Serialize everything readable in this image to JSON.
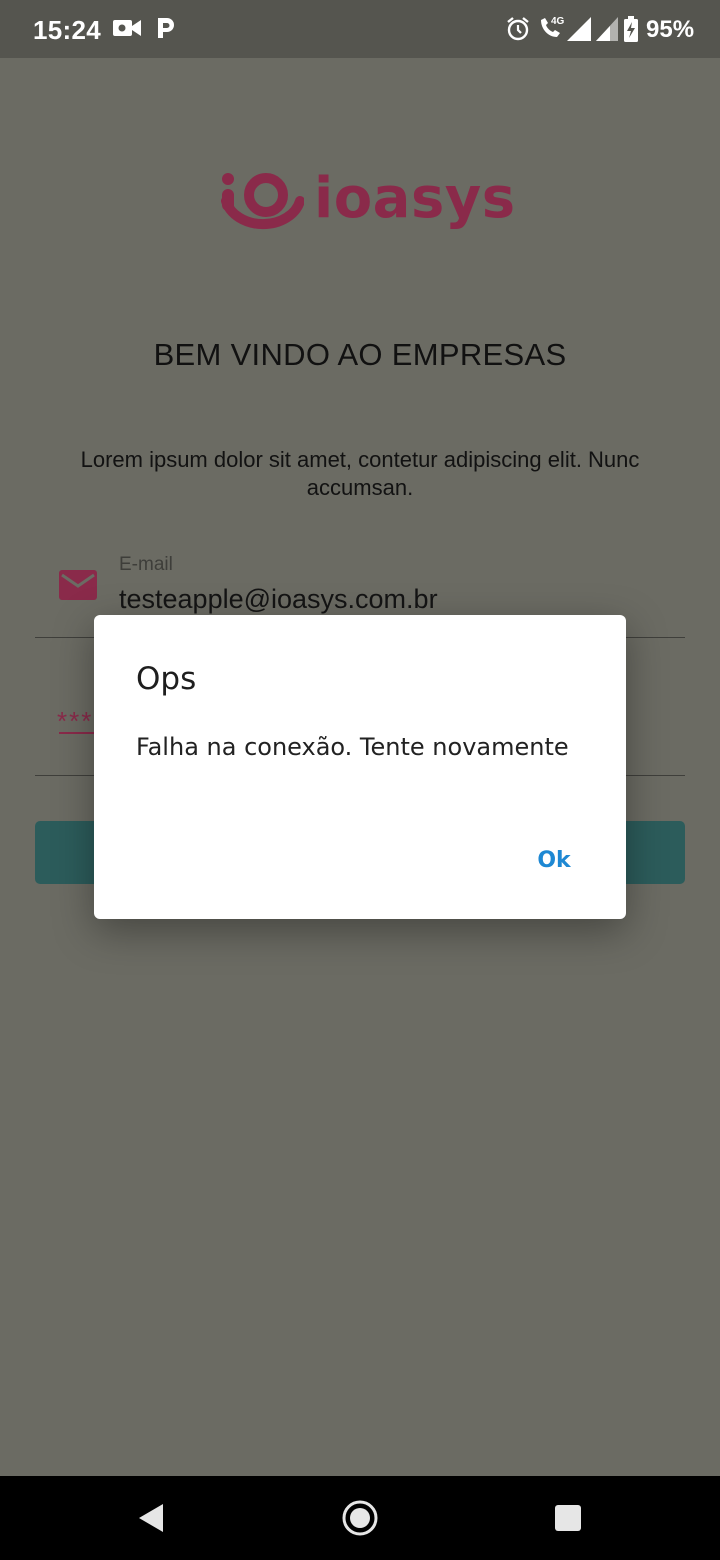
{
  "status_bar": {
    "time": "15:24",
    "battery_percent": "95%",
    "icons": [
      "video-camera-icon",
      "parking-icon",
      "alarm-icon",
      "volte-call-icon",
      "signal-icon",
      "signal-icon",
      "battery-charging-icon"
    ],
    "network_type": "4G"
  },
  "app": {
    "logo_text": "ioasys",
    "logo_color": "#8a2a4a",
    "welcome_title": "BEM VINDO AO EMPRESAS",
    "subtitle": "Lorem ipsum dolor sit amet, contetur adipiscing elit. Nunc accumsan.",
    "email_field": {
      "label": "E-mail",
      "value": "testeapple@ioasys.com.br",
      "icon": "mail-icon"
    },
    "password_field": {
      "masked_value": "***"
    },
    "accent_color": "#2c5c5b"
  },
  "dialog": {
    "title": "Ops",
    "message": "Falha na conexão. Tente novamente",
    "ok_label": "Ok",
    "ok_color": "#1e88d3"
  },
  "nav_bar": {
    "buttons": [
      "back-icon",
      "home-icon",
      "recents-icon"
    ]
  }
}
